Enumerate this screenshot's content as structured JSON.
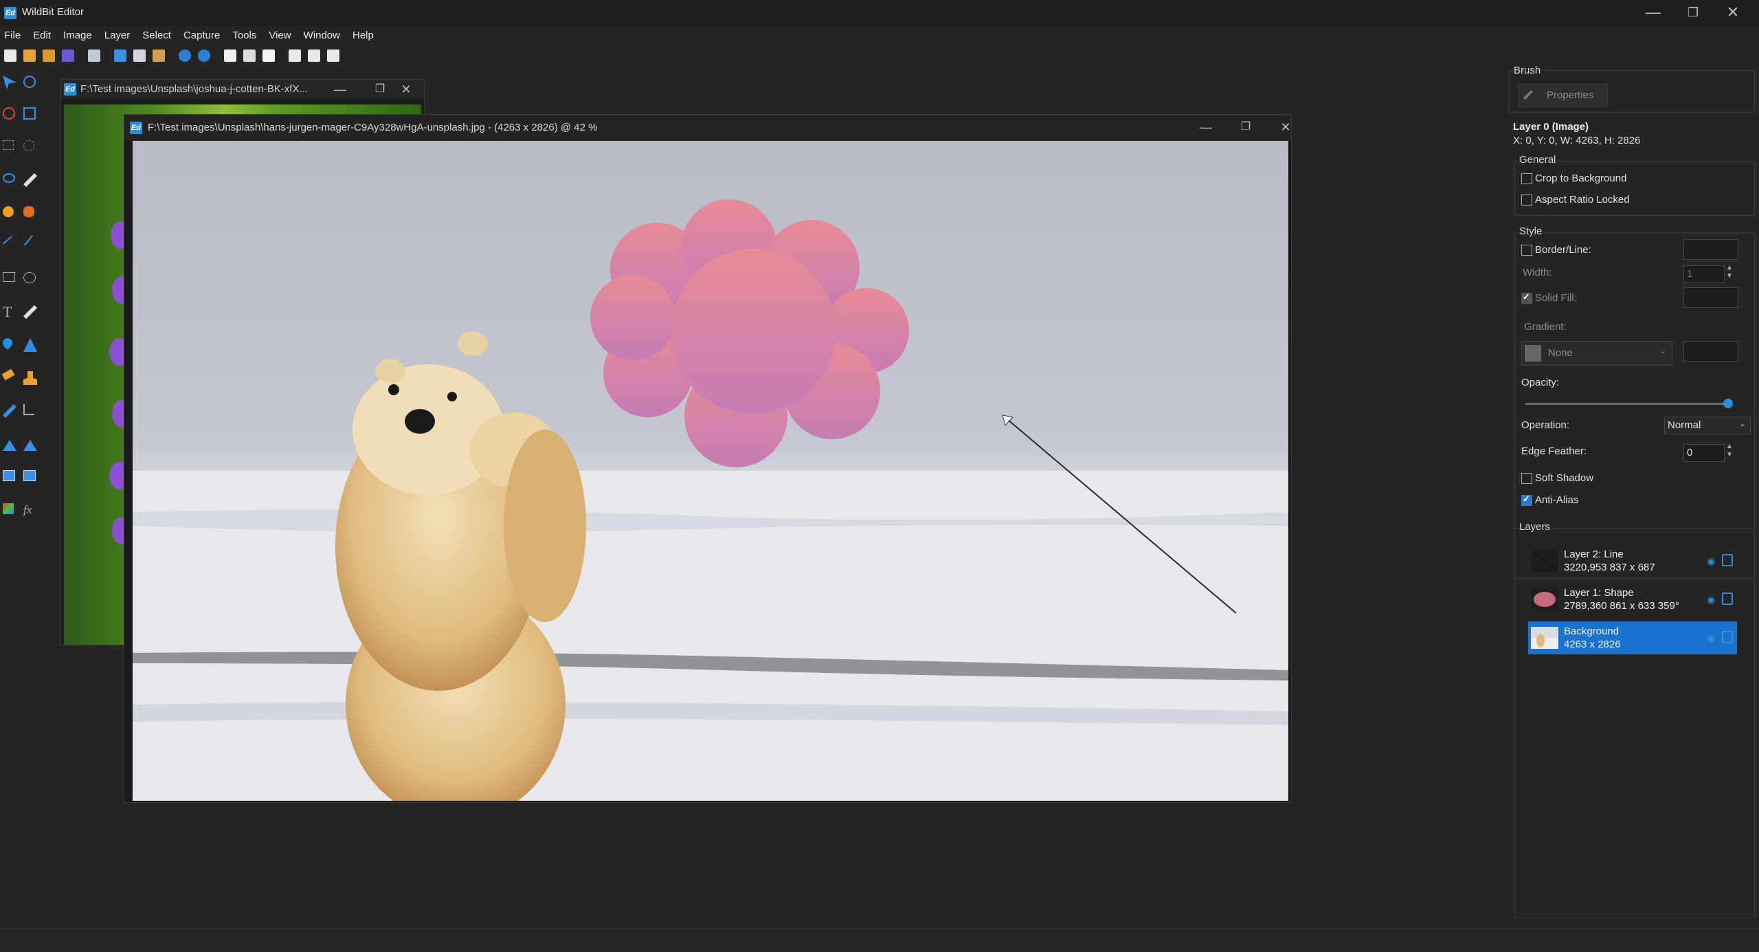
{
  "app": {
    "title": "WildBit Editor",
    "icon": "wildbit-app-icon"
  },
  "window_controls": {
    "minimize": "—",
    "restore": "❐",
    "close": "✕"
  },
  "menu": [
    "File",
    "Edit",
    "Image",
    "Layer",
    "Select",
    "Capture",
    "Tools",
    "View",
    "Window",
    "Help"
  ],
  "toolbar_icons": [
    "new-icon",
    "open-icon",
    "open-folder-icon",
    "save-icon",
    "print-icon",
    "cut-icon",
    "copy-icon",
    "paste-icon",
    "undo-icon",
    "redo-icon",
    "view-icon",
    "layer-arrange-icon",
    "layer-order-icon",
    "tile-horizontal-icon",
    "tile-columns-icon",
    "tile-vertical-icon"
  ],
  "documents": {
    "back": {
      "title": "F:\\Test images\\Unsplash\\joshua-j-cotten-BK-xfX..."
    },
    "main": {
      "title": "F:\\Test images\\Unsplash\\hans-jurgen-mager-C9Ay328wHgA-unsplash.jpg - (4263 x 2826) @ 42  %"
    }
  },
  "panel": {
    "brush_group": "Brush",
    "properties_button": "Properties",
    "layer_title": "Layer 0 (Image)",
    "layer_coords": "X: 0, Y: 0, W: 4263, H: 2826",
    "general_group": "General",
    "crop_to_background": "Crop to Background",
    "aspect_ratio_locked": "Aspect Ratio Locked",
    "style_group": "Style",
    "border_line": "Border/Line:",
    "width_label": "Width:",
    "width_value": "1",
    "solid_fill": "Solid Fill:",
    "gradient_label": "Gradient:",
    "gradient_value": "None",
    "opacity_label": "Opacity:",
    "opacity_value": 1.0,
    "operation_label": "Operation:",
    "operation_value": "Normal",
    "edge_feather_label": "Edge Feather:",
    "edge_feather_value": "0",
    "soft_shadow": "Soft Shadow",
    "anti_alias": "Anti-Alias",
    "layers_group": "Layers",
    "layers": [
      {
        "name": "Layer 2: Line",
        "info": "3220,953  837 x 687"
      },
      {
        "name": "Layer 1: Shape",
        "info": "2789,360  861 x 633  359°"
      },
      {
        "name": "Background",
        "info": "4263 x 2826"
      }
    ]
  },
  "colors": {
    "accent": "#1a73cf",
    "cloud_top": "#e88a96",
    "cloud_bottom": "#c57cb6",
    "background": "#252525"
  }
}
